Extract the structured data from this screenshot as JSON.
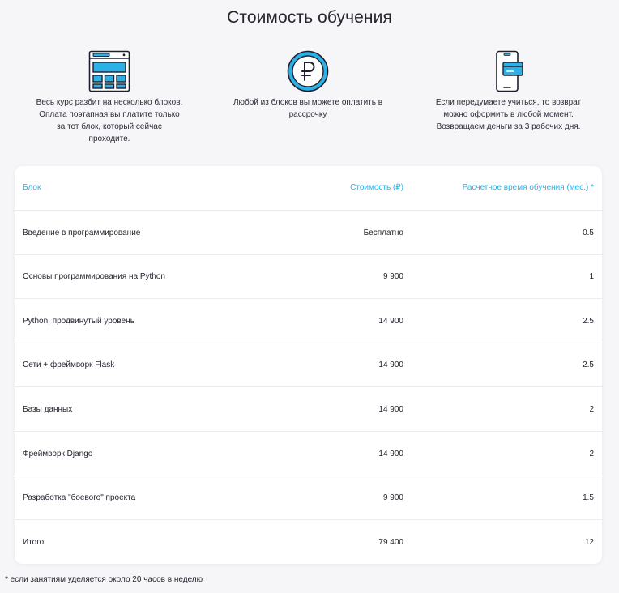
{
  "page": {
    "title": "Стоимость обучения",
    "accent_color": "#2bb1e6",
    "footnote": "* если занятиям уделяется около 20 часов в неделю"
  },
  "features": [
    {
      "icon": "browser-blocks-icon",
      "lines": [
        "Весь курс разбит на несколько блоков.",
        "Оплата поэтапная вы платите только",
        "за тот блок, который сейчас",
        "проходите."
      ]
    },
    {
      "icon": "ruble-coin-icon",
      "lines": [
        "Любой из блоков вы можете оплатить в",
        "рассрочку"
      ]
    },
    {
      "icon": "phone-card-icon",
      "lines": [
        "Если передумаете учиться, то возврат",
        "можно оформить в любой момент.",
        "Возвращаем деньги за 3 рабочих дня."
      ]
    }
  ],
  "table": {
    "headers": [
      "Блок",
      "Стоимость (₽)",
      "Расчетное время обучения (мес.) *"
    ],
    "rows": [
      [
        "Введение в программирование",
        "Бесплатно",
        "0.5"
      ],
      [
        "Основы программирования на Python",
        "9 900",
        "1"
      ],
      [
        "Python, продвинутый уровень",
        "14 900",
        "2.5"
      ],
      [
        "Сети + фреймворк Flask",
        "14 900",
        "2.5"
      ],
      [
        "Базы данных",
        "14 900",
        "2"
      ],
      [
        "Фреймворк Django",
        "14 900",
        "2"
      ],
      [
        "Разработка \"боевого\" проекта",
        "9 900",
        "1.5"
      ],
      [
        "Итого",
        "79 400",
        "12"
      ]
    ]
  }
}
